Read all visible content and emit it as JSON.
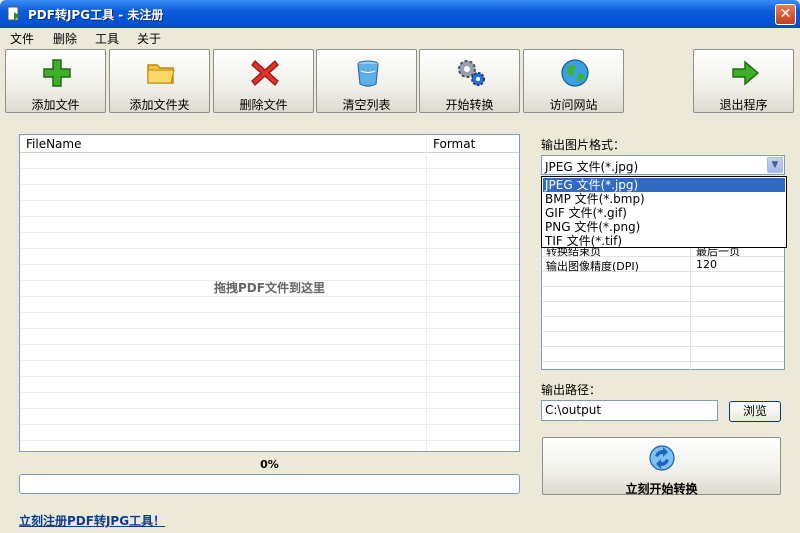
{
  "window": {
    "title": "PDF转JPG工具 - 未注册",
    "close": "✕"
  },
  "menu": [
    "文件",
    "删除",
    "工具",
    "关于"
  ],
  "toolbar": [
    {
      "label": "添加文件",
      "icon": "plus-icon"
    },
    {
      "label": "添加文件夹",
      "icon": "folder-icon"
    },
    {
      "label": "删除文件",
      "icon": "delete-x-icon"
    },
    {
      "label": "清空列表",
      "icon": "trash-icon"
    },
    {
      "label": "开始转换",
      "icon": "gears-icon"
    },
    {
      "label": "访问网站",
      "icon": "globe-icon"
    },
    {
      "label": "退出程序",
      "icon": "exit-arrow-icon"
    }
  ],
  "file_list": {
    "columns": [
      "FileName",
      "Format"
    ],
    "drop_hint": "拖拽PDF文件到这里"
  },
  "progress": {
    "label": "0%",
    "value": 0
  },
  "register_link": "立刻注册PDF转JPG工具！",
  "output_format": {
    "label": "输出图片格式：",
    "selected": "JPEG 文件(*.jpg)",
    "options": [
      "JPEG 文件(*.jpg)",
      "BMP 文件(*.bmp)",
      "GIF 文件(*.gif)",
      "PNG 文件(*.png)",
      "TIF 文件(*.tif)"
    ]
  },
  "options": [
    {
      "key": "转换结束页",
      "value": "最后一页"
    },
    {
      "key": "输出图像精度(DPI)",
      "value": "120"
    }
  ],
  "output_path": {
    "label": "输出路径：",
    "value": "C:\\output",
    "browse": "浏览"
  },
  "start_button": {
    "label": "立刻开始转换",
    "icon": "convert-refresh-icon"
  },
  "colors": {
    "titlebar": "#0553d6",
    "selection": "#316ac5"
  }
}
